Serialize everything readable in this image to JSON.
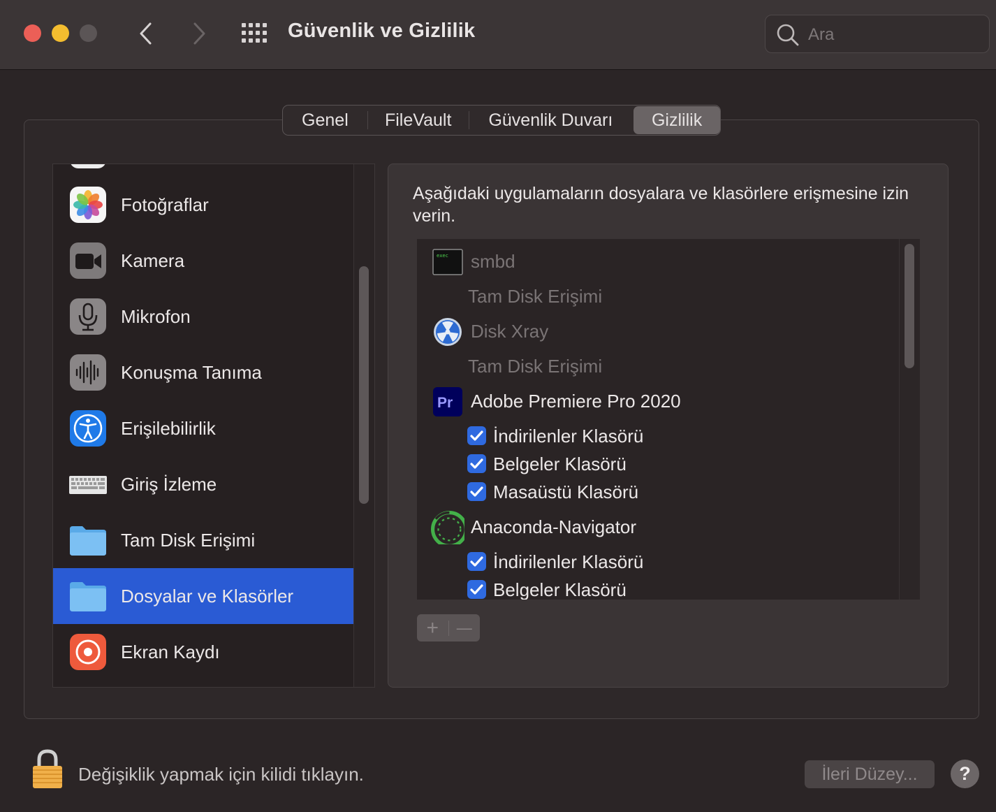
{
  "window": {
    "title": "Güvenlik ve Gizlilik",
    "search_placeholder": "Ara"
  },
  "tabs": [
    {
      "label": "Genel",
      "selected": false
    },
    {
      "label": "FileVault",
      "selected": false
    },
    {
      "label": "Güvenlik Duvarı",
      "selected": false
    },
    {
      "label": "Gizlilik",
      "selected": true
    }
  ],
  "sidebar": {
    "items": [
      {
        "label": "Fotoğraflar",
        "icon": "photos-icon"
      },
      {
        "label": "Kamera",
        "icon": "camera-icon"
      },
      {
        "label": "Mikrofon",
        "icon": "microphone-icon"
      },
      {
        "label": "Konuşma Tanıma",
        "icon": "speech-recognition-icon"
      },
      {
        "label": "Erişilebilirlik",
        "icon": "accessibility-icon"
      },
      {
        "label": "Giriş İzleme",
        "icon": "keyboard-icon"
      },
      {
        "label": "Tam Disk Erişimi",
        "icon": "folder-icon"
      },
      {
        "label": "Dosyalar ve Klasörler",
        "icon": "folder-icon",
        "selected": true
      },
      {
        "label": "Ekran Kaydı",
        "icon": "screen-recording-icon"
      }
    ]
  },
  "main": {
    "description": "Aşağıdaki uygulamaların dosyalara ve klasörlere erişmesine izin verin.",
    "apps": [
      {
        "name": "smbd",
        "icon": "exec-icon",
        "dimmed": true,
        "sub": "Tam Disk Erişimi"
      },
      {
        "name": "Disk Xray",
        "icon": "disk-xray-icon",
        "dimmed": true,
        "sub": "Tam Disk Erişimi"
      },
      {
        "name": "Adobe Premiere Pro 2020",
        "icon": "premiere-icon",
        "dimmed": false,
        "folders": [
          "İndirilenler Klasörü",
          "Belgeler Klasörü",
          "Masaüstü Klasörü"
        ]
      },
      {
        "name": "Anaconda-Navigator",
        "icon": "anaconda-icon",
        "dimmed": false,
        "folders": [
          "İndirilenler Klasörü",
          "Belgeler Klasörü"
        ]
      }
    ],
    "exec_badge": "exec",
    "premiere_badge": "Pr",
    "add_symbol": "+",
    "remove_symbol": "—"
  },
  "footer": {
    "lock_text": "Değişiklik yapmak için kilidi tıklayın.",
    "advanced_button": "İleri Düzey...",
    "help_button": "?"
  },
  "colors": {
    "selection": "#2a5bd4",
    "checkbox": "#2f6ae0",
    "close": "#ec5f57",
    "minimize": "#f4bd2f"
  }
}
